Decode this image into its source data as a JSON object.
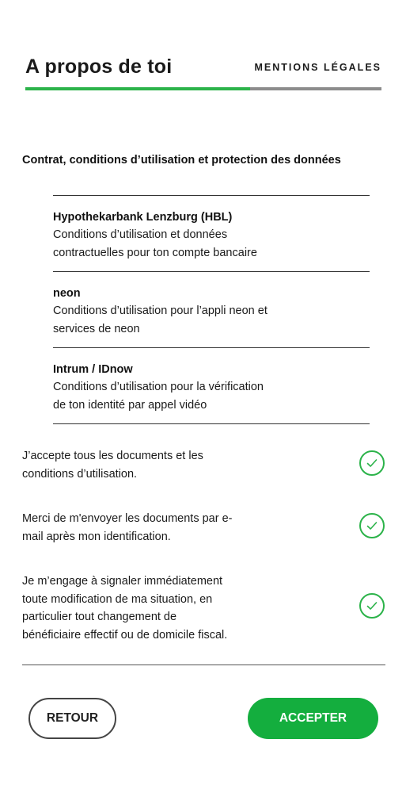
{
  "header": {
    "title": "A propos de toi",
    "tab_legal": "MENTIONS LÉGALES",
    "progress_fraction": 0.63
  },
  "section_heading": "Contrat, conditions d’utilisation et protection des données",
  "documents": [
    {
      "name": "Hypothekarbank Lenzburg (HBL)",
      "desc_line1": "Conditions d’utilisation et données",
      "desc_line2": "contractuelles pour ton compte bancaire"
    },
    {
      "name": "neon",
      "desc_line1": "Conditions d’utilisation pour l’appli neon et",
      "desc_line2": "services de neon"
    },
    {
      "name": "Intrum / IDnow",
      "desc_line1": "Conditions d’utilisation pour la vérification",
      "desc_line2": "de ton identité par appel vidéo"
    }
  ],
  "consents": [
    {
      "lines": [
        "J’accepte tous les documents et les",
        "conditions d’utilisation."
      ],
      "checked": true
    },
    {
      "lines": [
        "Merci de m'envoyer les documents par e-",
        "mail après mon identification."
      ],
      "checked": true
    },
    {
      "lines": [
        "Je m’engage à signaler immédiatement",
        "toute modification de ma situation, en",
        "particulier tout changement de",
        "bénéficiaire effectif ou de domicile fiscal."
      ],
      "checked": true
    }
  ],
  "buttons": {
    "back_label": "RETOUR",
    "accept_label": "ACCEPTER"
  },
  "colors": {
    "accent_green": "#2cb34a",
    "button_green": "#14ae3e",
    "progress_track": "#8c8c8c"
  }
}
